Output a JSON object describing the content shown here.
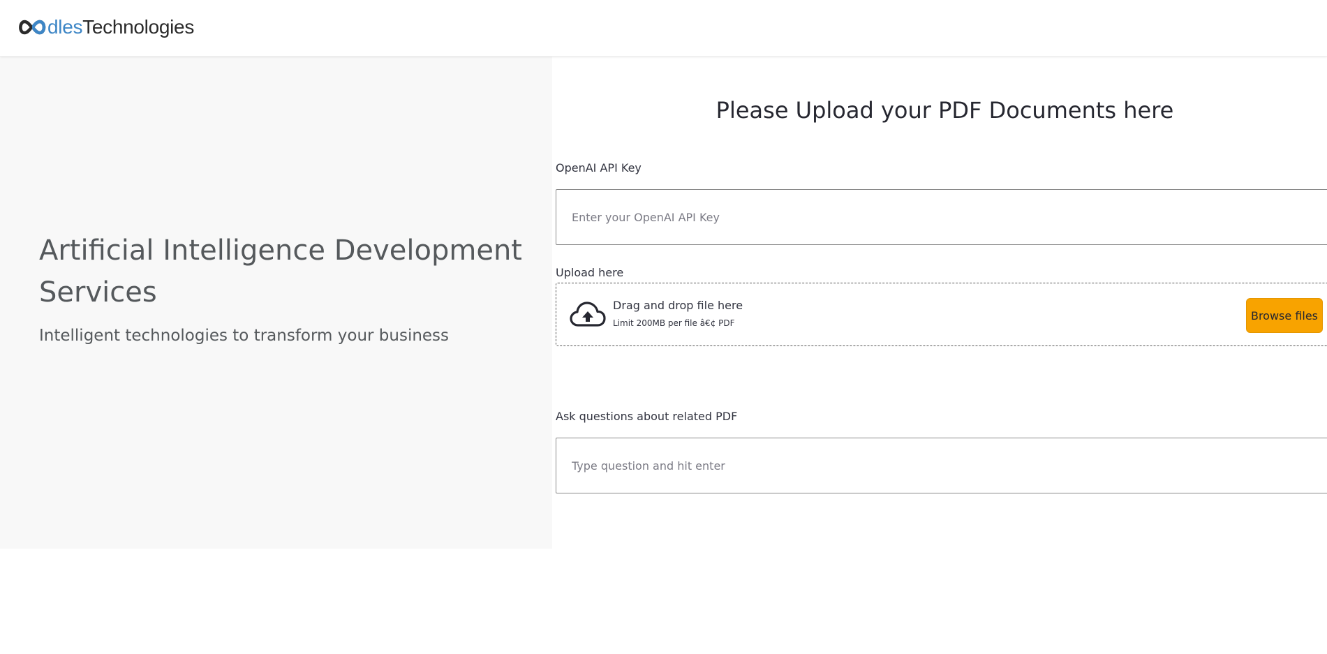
{
  "header": {
    "logo": {
      "mark_icon": "infinity-loop-logo",
      "o_part": "dles",
      "brand_part": "Technologies",
      "accent_color": "#3d86c6",
      "dark_color": "#2b2b2b"
    }
  },
  "hero": {
    "title": "Artificial Intelligence Development Services",
    "subtitle": "Intelligent technologies to transform your business"
  },
  "upload_panel": {
    "title": "Please Upload your PDF Documents here",
    "api_key": {
      "label": "OpenAI API Key",
      "value": "",
      "placeholder": "Enter your OpenAI API Key"
    },
    "uploader": {
      "label": "Upload here",
      "icon": "cloud-upload-icon",
      "drop_text": "Drag and drop file here",
      "limit_text": "Limit 200MB per file â€¢ PDF",
      "browse_label": "Browse files",
      "browse_color": "#f8a300"
    },
    "question": {
      "label": "Ask questions about related PDF",
      "value": "",
      "placeholder": "Type question and hit enter"
    }
  }
}
